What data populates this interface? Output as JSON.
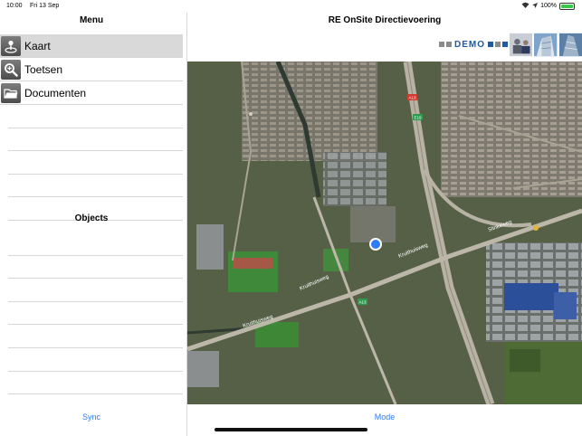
{
  "status_bar": {
    "time": "10:00",
    "date": "Fri 13 Sep",
    "battery": "100%"
  },
  "sidebar": {
    "title": "Menu",
    "items": [
      {
        "label": "Kaart",
        "icon": "map-pin-icon",
        "selected": true
      },
      {
        "label": "Toetsen",
        "icon": "magnifier-icon",
        "selected": false
      },
      {
        "label": "Documenten",
        "icon": "folder-icon",
        "selected": false
      }
    ],
    "objects_title": "Objects",
    "sync_label": "Sync"
  },
  "main": {
    "title": "RE OnSite Directievoering",
    "banner_text": "DEMO",
    "mode_label": "Mode",
    "map": {
      "roads": [
        "Kruithuisweg",
        "Kruithuisweg",
        "Kruithuisweg",
        "Slinkeweg"
      ],
      "road_badges": [
        "A13",
        "E19",
        "A13"
      ]
    }
  },
  "colors": {
    "accent": "#2f7cf6",
    "location_dot": "#2f7cf6",
    "banner_blue": "#1d5aa8"
  }
}
